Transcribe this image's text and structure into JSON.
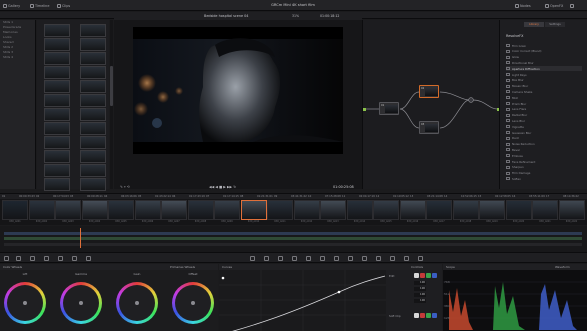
{
  "topbar": {
    "gallery": "Gallery",
    "timeline": "Timeline",
    "clips": "Clips",
    "project_title": "GRCm Mini 4K short film",
    "nodes": "Nodes",
    "openfx": "OpenFX",
    "lightbox": "Lightbox"
  },
  "viewer": {
    "clip_title": "Bedside hospital scene 04",
    "zoom": "31%",
    "timecode_top": "01:00:18:12",
    "timecode": "01:00:25:08"
  },
  "fx": {
    "tabs": [
      "Library",
      "Settings"
    ],
    "active_tab": "Library",
    "heading": "ResolveFX",
    "items": [
      "Film Grain",
      "Color Correct (Blend)",
      "Glow",
      "Directional Blur",
      "Aperture Diffraction",
      "Light Rays",
      "Box Blur",
      "Mosaic Blur",
      "Camera Shake",
      "Mist",
      "Prism Blur",
      "Lens Flare",
      "Radial Blur",
      "Lens Blur",
      "Vignette",
      "Gaussian Blur",
      "Dent",
      "Noise Reduction",
      "Bevel",
      "Emboss",
      "Face Refinement",
      "Sharpen",
      "Film Damage",
      "Soften"
    ],
    "highlighted": "Aperture Diffraction"
  },
  "clip_info": [
    "01",
    "00:00:33:23",
    "02",
    "00:17:54:03",
    "03",
    "00:09:28:11",
    "04",
    "06:03:16:06",
    "05",
    "01:43:22:14",
    "06",
    "01:17:43:19",
    "07",
    "01:17:14:15",
    "08",
    "01:21:31:01",
    "09",
    "03:41:31:22",
    "10",
    "07:15:28:08",
    "11",
    "02:04:17:19",
    "12",
    "01:19:05:12",
    "13",
    "03:21:14:08",
    "14",
    "10:52:06:15",
    "15",
    "02:12:58:05",
    "16",
    "03:55:11:09",
    "17",
    "08:14:36:22"
  ],
  "clip_labels": [
    "R3D_A001",
    "R3D_A002",
    "R3D_A003",
    "R3D_A004",
    "R3D_A005",
    "R3D_A006",
    "R3D_A007",
    "R3D_A008",
    "R3D_A009",
    "R3D_A010",
    "R3D_A011",
    "R3D_A012",
    "R3D_A013",
    "R3D_A014",
    "R3D_A015",
    "R3D_A016",
    "R3D_A017",
    "R3D_A018",
    "R3D_A019",
    "R3D_A020",
    "R3D_A021",
    "R3D_A022"
  ],
  "panels": {
    "color_wheels": "Color Wheels",
    "primaries": "Primaries Wheels",
    "curves": "Curves",
    "controls": "Controls",
    "scope": "Scope",
    "mode": "Waveform"
  },
  "wheels": [
    {
      "label": "Lift",
      "readout": "0.00  0.00  0.00  0.00"
    },
    {
      "label": "Gamma",
      "readout": "0.00  0.00  0.00  0.00"
    },
    {
      "label": "Gain",
      "readout": "1.00  1.00  1.00  1.00"
    },
    {
      "label": "Offset",
      "readout": "25.00  25.00  25.00"
    }
  ],
  "curve_controls": {
    "edit": "Edit",
    "values": [
      "100",
      "100",
      "100",
      "100"
    ],
    "soft_clip": "Soft Clip"
  },
  "nodes": [
    {
      "num": "01"
    },
    {
      "num": "02"
    },
    {
      "num": "03"
    }
  ],
  "colors": {
    "accent": "#e0703a",
    "port": "#8bc34a",
    "bg": "#1b1b1d"
  }
}
